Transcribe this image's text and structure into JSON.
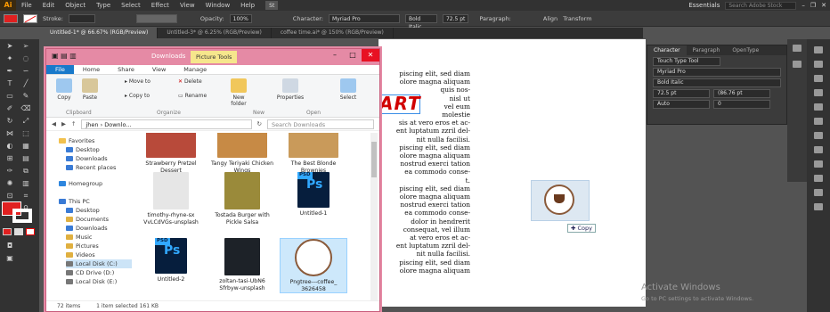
{
  "app": {
    "logo": "Ai",
    "menu": [
      "File",
      "Edit",
      "Object",
      "Type",
      "Select",
      "Effect",
      "View",
      "Window",
      "Help"
    ],
    "zoom_badge": "St",
    "workspace": "Essentials",
    "search_placeholder": "Search Adobe Stock"
  },
  "control": {
    "stroke_label": "Stroke:",
    "opacity_label": "Opacity:",
    "opacity_value": "100%",
    "character_label": "Character:",
    "font": "Myriad Pro",
    "style": "Bold Italic",
    "size": "72.5 pt",
    "paragraph_label": "Paragraph:",
    "align_label": "Align",
    "transform_label": "Transform",
    "fill_color": "#e02020"
  },
  "doc_tabs": [
    "Untitled-1* @ 66.67% (RGB/Preview)",
    "Untitled-3* @ 6.25% (RGB/Preview)",
    "coffee time.ai* @ 150% (RGB/Preview)"
  ],
  "canvas": {
    "art_word": "ART",
    "lorem_lines": [
      "piscing elit, sed diam",
      "olore magna aliquam",
      "quis nos-",
      "nisl ut",
      "vel eum",
      "molestie",
      "sis at vero eros et ac-",
      "ent luptatum zzril del-",
      "nit nulla facilisi.",
      "piscing elit, sed diam",
      "olore magna aliquam",
      "nostrud exerci tation",
      "ea commodo conse-",
      "t.",
      "piscing elit, sed diam",
      "olore magna aliquam",
      "nostrud exerci tation",
      "ea commodo conse-",
      "dolor in hendrerit",
      "consequat, vel illum",
      "at vero eros et ac-",
      "ent luptatum zzril del-",
      "nit nulla facilisi.",
      "piscing elit, sed diam",
      "olore magna aliquam"
    ],
    "drag_copy": "Copy"
  },
  "watermark": {
    "title": "Activate Windows",
    "sub": "Go to PC settings to activate Windows."
  },
  "panel": {
    "tabs": [
      "Character",
      "Paragraph",
      "OpenType"
    ],
    "tool": "Touch Type Tool",
    "font": "Myriad Pro",
    "style": "Bold Italic",
    "size": "72.5 pt",
    "leading": "(86.76 pt",
    "tracking": "Auto",
    "kerning": "0"
  },
  "explorer": {
    "title": "Downloads",
    "picture_tools": "Picture Tools",
    "ribbon_tabs": [
      "File",
      "Home",
      "Share",
      "View",
      "Manage"
    ],
    "ribbon": {
      "copy": "Copy",
      "paste": "Paste",
      "clipboard": "Clipboard",
      "move_to": "Move to",
      "copy_to": "Copy to",
      "delete": "Delete",
      "rename": "Rename",
      "organize": "Organize",
      "new_folder": "New folder",
      "new": "New",
      "properties": "Properties",
      "open": "Open",
      "select": "Select"
    },
    "path": "jhen  ›  Downlo...",
    "search": "Search Downloads",
    "nav": [
      {
        "label": "Favorites",
        "c": "#f2c14e"
      },
      {
        "label": "Desktop",
        "c": "#3a7bd5"
      },
      {
        "label": "Downloads",
        "c": "#3a7bd5"
      },
      {
        "label": "Recent places",
        "c": "#3a7bd5"
      },
      {
        "label": "Homegroup",
        "c": "#2e86de"
      },
      {
        "label": "This PC",
        "c": "#3a7bd5"
      },
      {
        "label": "Desktop",
        "c": "#3a7bd5"
      },
      {
        "label": "Documents",
        "c": "#e0b040"
      },
      {
        "label": "Downloads",
        "c": "#3a7bd5"
      },
      {
        "label": "Music",
        "c": "#e0b040"
      },
      {
        "label": "Pictures",
        "c": "#e0b040"
      },
      {
        "label": "Videos",
        "c": "#e0b040"
      },
      {
        "label": "Local Disk (C:)",
        "c": "#777"
      },
      {
        "label": "CD Drive (D:)",
        "c": "#777"
      },
      {
        "label": "Local Disk (E:)",
        "c": "#777"
      }
    ],
    "items": [
      {
        "label": "Strawberry Pretzel Dessert",
        "c": "#b84a3a"
      },
      {
        "label": "Tangy Teriyaki Chicken Wings",
        "c": "#c78a45"
      },
      {
        "label": "The Best Blonde Brownies",
        "c": "#c99a5a"
      },
      {
        "label": "timothy-rhyne-sx VvLCdVGs-unsplash",
        "c": "#e6e6e6"
      },
      {
        "label": "Tostada Burger with Pickle Salsa",
        "c": "#9a8a3a"
      },
      {
        "label": "Untitled-1",
        "c": "psd"
      },
      {
        "label": "Untitled-2",
        "c": "psd"
      },
      {
        "label": "zoltan-tasi-UbN6 Sfrbyw-unsplash",
        "c": "#1d2228"
      },
      {
        "label": "Pngtree---coffee_ 3626458",
        "c": "logo"
      }
    ],
    "status_count": "72 items",
    "status_sel": "1 item selected  161 KB"
  }
}
